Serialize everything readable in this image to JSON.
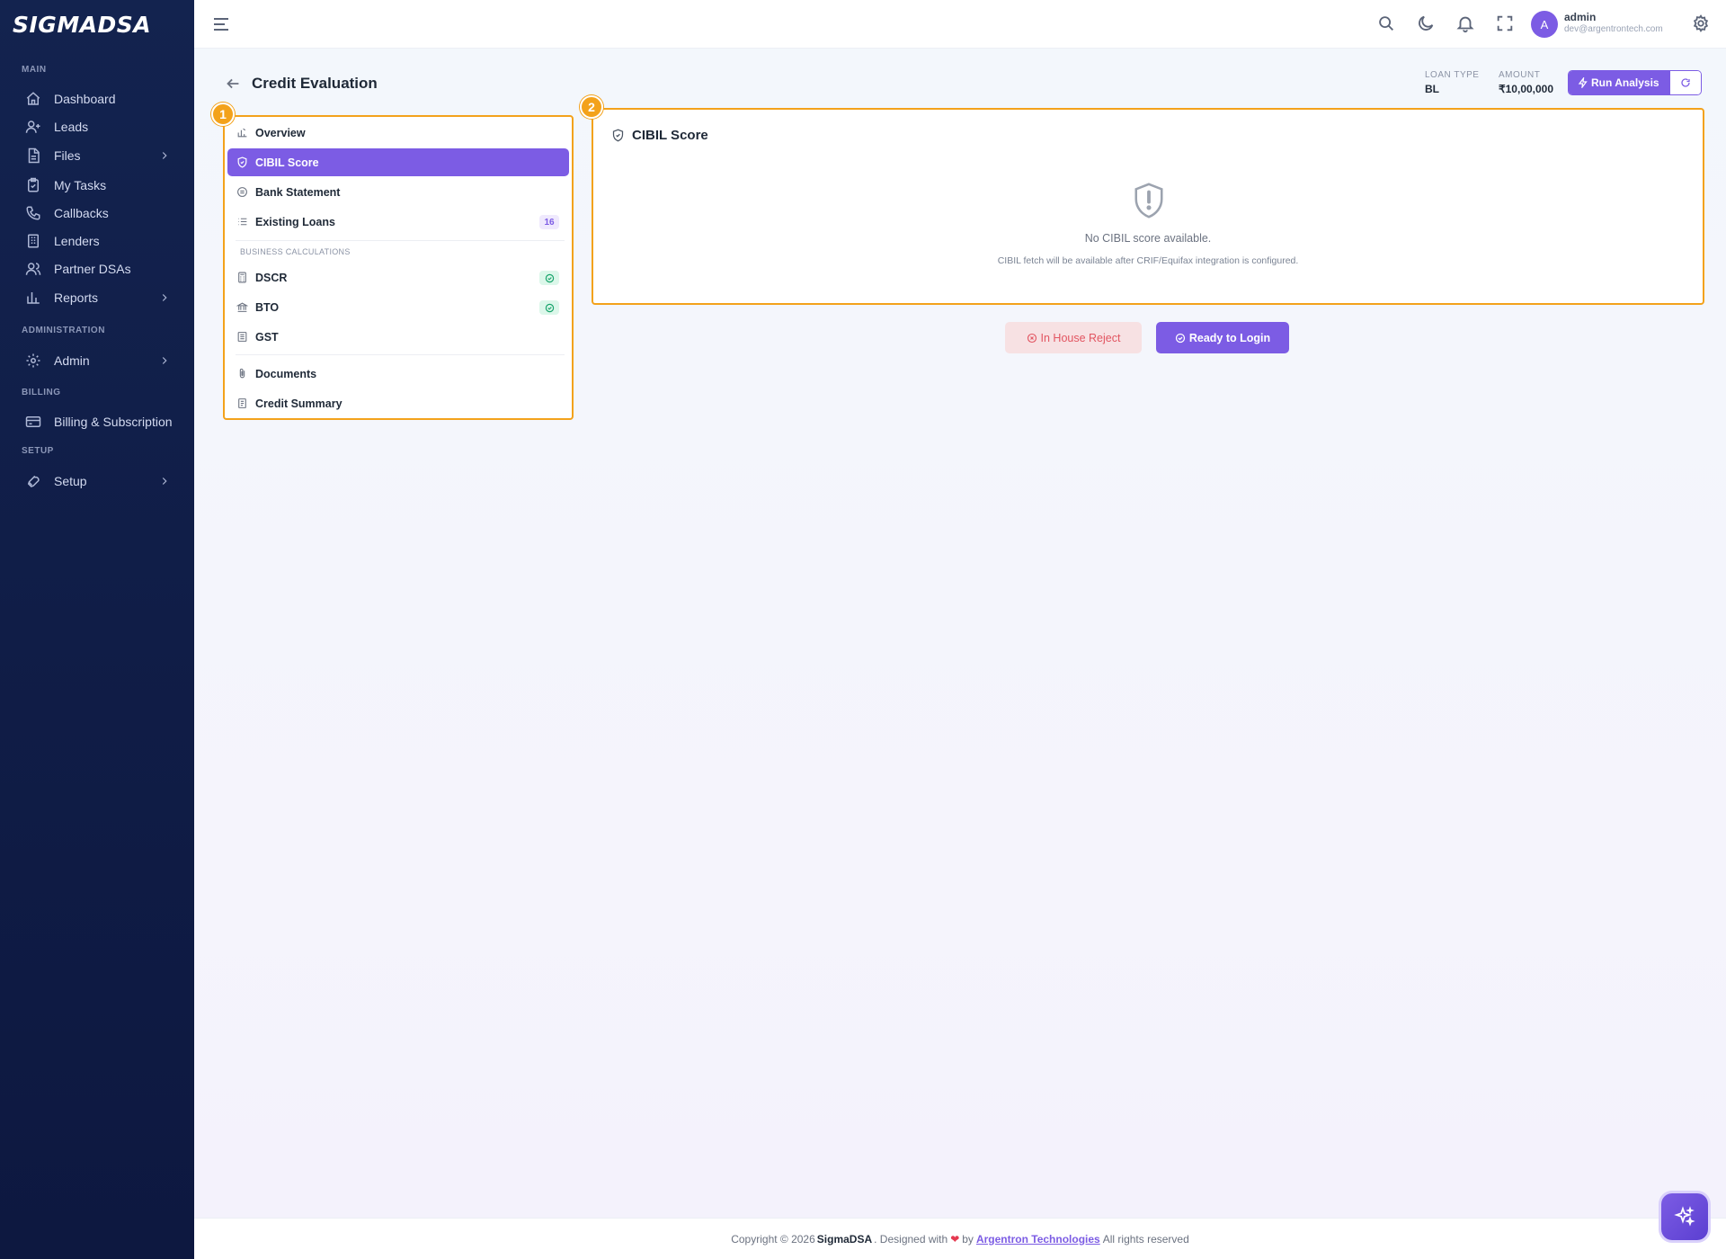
{
  "brand": {
    "name": "SIGMADSA"
  },
  "sidebar": {
    "sections": {
      "main": "MAIN",
      "administration": "ADMINISTRATION",
      "billing": "BILLING",
      "setup": "SETUP"
    },
    "items": [
      {
        "label": "Dashboard",
        "icon": "home-icon"
      },
      {
        "label": "Leads",
        "icon": "user-plus-icon"
      },
      {
        "label": "Files",
        "icon": "file-icon",
        "has_children": true
      },
      {
        "label": "My Tasks",
        "icon": "clipboard-check-icon"
      },
      {
        "label": "Callbacks",
        "icon": "phone-icon"
      },
      {
        "label": "Lenders",
        "icon": "building-icon"
      },
      {
        "label": "Partner DSAs",
        "icon": "users-icon"
      },
      {
        "label": "Reports",
        "icon": "bar-chart-icon",
        "has_children": true
      },
      {
        "label": "Admin",
        "icon": "gear-icon",
        "has_children": true
      },
      {
        "label": "Billing & Subscription",
        "icon": "credit-card-icon"
      },
      {
        "label": "Setup",
        "icon": "wrench-icon",
        "has_children": true
      }
    ]
  },
  "topbar": {
    "avatar_letter": "A",
    "user_name": "admin",
    "user_email": "dev@argentrontech.com"
  },
  "page": {
    "title": "Credit Evaluation",
    "loan_type_label": "LOAN TYPE",
    "loan_type_value": "BL",
    "amount_label": "AMOUNT",
    "amount_value": "₹10,00,000",
    "run_analysis_label": "Run Analysis"
  },
  "steps": {
    "one": "1",
    "two": "2"
  },
  "nav": {
    "items": [
      {
        "label": "Overview",
        "icon": "bar-chart-icon"
      },
      {
        "label": "CIBIL Score",
        "icon": "shield-icon",
        "active": true
      },
      {
        "label": "Bank Statement",
        "icon": "bank-icon"
      },
      {
        "label": "Existing Loans",
        "icon": "list-icon",
        "badge": "16"
      }
    ],
    "section_label": "BUSINESS CALCULATIONS",
    "business": [
      {
        "label": "DSCR",
        "icon": "calculator-icon",
        "checked": true
      },
      {
        "label": "BTO",
        "icon": "bank-icon",
        "checked": true
      },
      {
        "label": "GST",
        "icon": "receipt-icon"
      }
    ],
    "other": [
      {
        "label": "Documents",
        "icon": "paperclip-icon"
      },
      {
        "label": "Credit Summary",
        "icon": "document-icon"
      }
    ]
  },
  "cibil": {
    "title": "CIBIL Score",
    "empty_title": "No CIBIL score available.",
    "empty_subtitle": "CIBIL fetch will be available after CRIF/Equifax integration is configured."
  },
  "actions": {
    "reject_label": "In House Reject",
    "ready_label": "Ready to Login"
  },
  "footer": {
    "prefix": "Copyright © 2026",
    "brand": "SigmaDSA",
    "middle": ". Designed with",
    "by": "by",
    "company": "Argentron Technologies",
    "suffix": "All rights reserved"
  },
  "colors": {
    "accent": "#7c5ce4",
    "highlight_border": "#f3a21b",
    "sidebar_bg": "#13234f",
    "reject_bg": "#f7e1e3",
    "reject_text": "#e25561"
  }
}
